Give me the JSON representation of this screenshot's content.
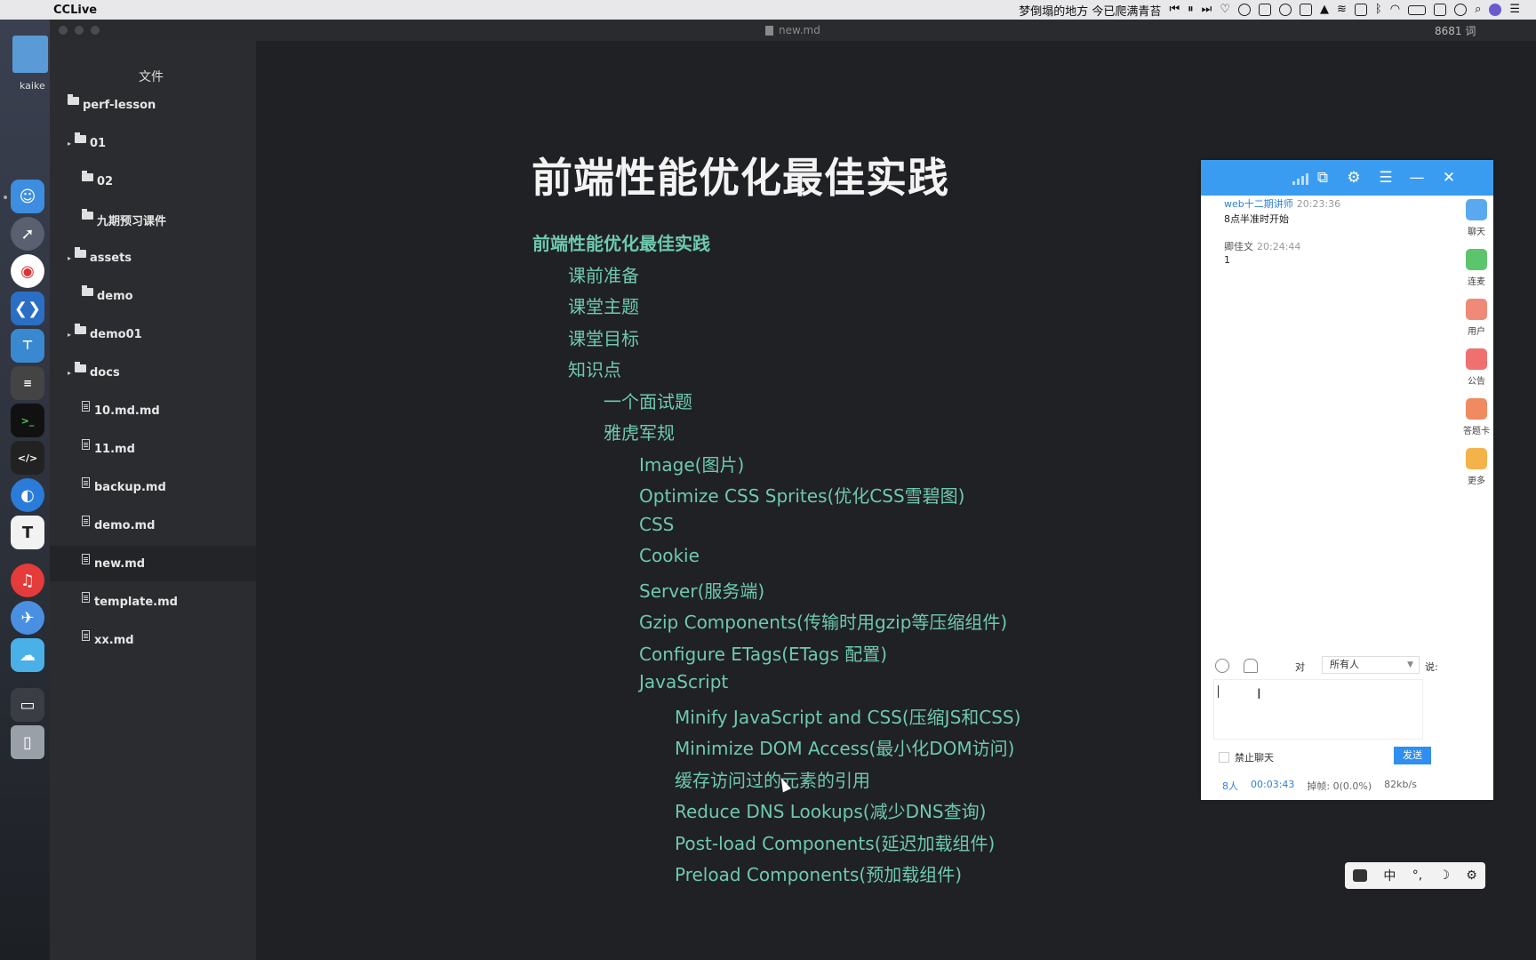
{
  "menubar": {
    "app_name": "CCLive",
    "now_playing": "梦倒塌的地方 今已爬满青苔"
  },
  "window": {
    "document_name": "new.md",
    "word_count": "8681 词"
  },
  "desktop": {
    "item_label": "kaike"
  },
  "sidebar": {
    "title": "文件",
    "items": [
      {
        "label": "perf-lesson",
        "type": "folder",
        "arrow": ""
      },
      {
        "label": "01",
        "type": "folder",
        "arrow": "▸"
      },
      {
        "label": "02",
        "type": "folder",
        "arrow": ""
      },
      {
        "label": "九期预习课件",
        "type": "folder",
        "arrow": ""
      },
      {
        "label": "assets",
        "type": "folder",
        "arrow": "▸"
      },
      {
        "label": "demo",
        "type": "folder",
        "arrow": ""
      },
      {
        "label": "demo01",
        "type": "folder",
        "arrow": "▸"
      },
      {
        "label": "docs",
        "type": "folder",
        "arrow": "▸"
      },
      {
        "label": "10.md.md",
        "type": "file",
        "arrow": ""
      },
      {
        "label": "11.md",
        "type": "file",
        "arrow": ""
      },
      {
        "label": "backup.md",
        "type": "file",
        "arrow": ""
      },
      {
        "label": "demo.md",
        "type": "file",
        "arrow": ""
      },
      {
        "label": "new.md",
        "type": "file",
        "arrow": "",
        "selected": true
      },
      {
        "label": "template.md",
        "type": "file",
        "arrow": ""
      },
      {
        "label": "xx.md",
        "type": "file",
        "arrow": ""
      }
    ]
  },
  "document": {
    "title": "前端性能优化最佳实践",
    "toc": [
      {
        "text": "前端性能优化最佳实践",
        "level": 0
      },
      {
        "text": "课前准备",
        "level": 1
      },
      {
        "text": "课堂主题",
        "level": 1
      },
      {
        "text": "课堂目标",
        "level": 1
      },
      {
        "text": "知识点",
        "level": 1
      },
      {
        "text": "一个面试题",
        "level": 2
      },
      {
        "text": "雅虎军规",
        "level": 2
      },
      {
        "text": "Image(图片)",
        "level": 3
      },
      {
        "text": "Optimize CSS Sprites(优化CSS雪碧图)",
        "level": 3
      },
      {
        "text": "CSS",
        "level": 3
      },
      {
        "text": "Cookie",
        "level": 3
      },
      {
        "text": "Server(服务端)",
        "level": 3
      },
      {
        "text": "Gzip Components(传输时用gzip等压缩组件)",
        "level": 3
      },
      {
        "text": "Configure ETags(ETags 配置)",
        "level": 3
      },
      {
        "text": "JavaScript",
        "level": 3
      },
      {
        "text": "Minify JavaScript and CSS(压缩JS和CSS)",
        "level": 4
      },
      {
        "text": "Minimize DOM Access(最小化DOM访问)",
        "level": 4
      },
      {
        "text": "缓存访问过的元素的引用",
        "level": 4
      },
      {
        "text": "Reduce DNS Lookups(减少DNS查询)",
        "level": 4
      },
      {
        "text": "Post-load Components(延迟加载组件)",
        "level": 4
      },
      {
        "text": "Preload Components(预加载组件)",
        "level": 4
      }
    ]
  },
  "chat": {
    "messages": [
      {
        "sender": "web十二期讲师",
        "time": "20:23:36",
        "text": "8点半准时开始"
      },
      {
        "sender": "卿佳文",
        "time": "20:24:44",
        "text": "1"
      }
    ],
    "side_tabs": [
      {
        "label": "聊天",
        "color": "#5aa8ee"
      },
      {
        "label": "连麦",
        "color": "#5cc46c"
      },
      {
        "label": "用户",
        "color": "#f08a78"
      },
      {
        "label": "公告",
        "color": "#f07070"
      },
      {
        "label": "答题卡",
        "color": "#f08a60"
      },
      {
        "label": "更多",
        "color": "#f4b24a"
      }
    ],
    "to_label": "对",
    "recipient": "所有人",
    "say_label": "说:",
    "ban_chat_label": "禁止聊天",
    "send_label": "发送",
    "status": {
      "people": "8人",
      "duration": "00:03:43",
      "dropped_frames": "掉帧: 0(0.0%)",
      "bitrate": "82kb/s"
    }
  },
  "ime": {
    "mode": "中",
    "punct": "°,",
    "moon": "☽",
    "gear": "⚙"
  }
}
